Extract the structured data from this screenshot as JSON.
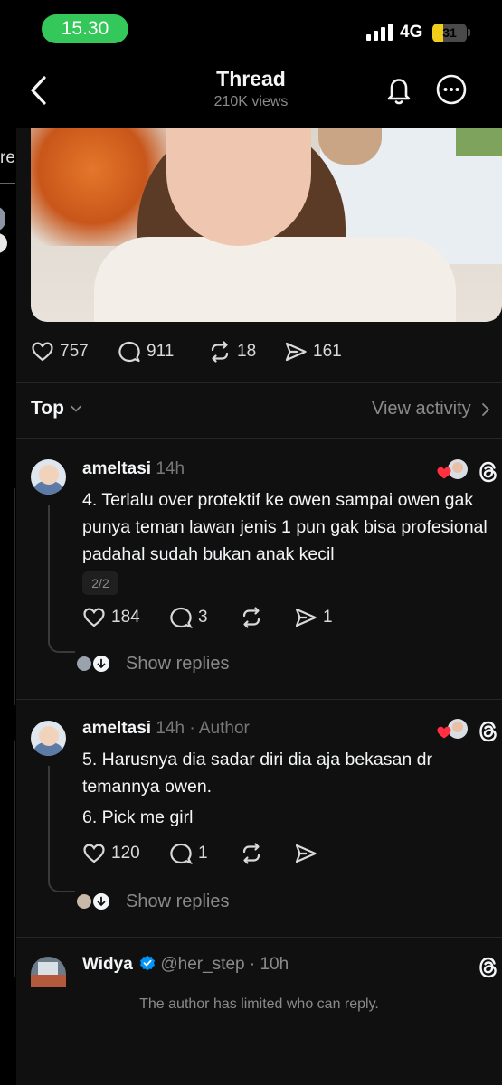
{
  "status_bar": {
    "time": "15.30",
    "network": "4G",
    "battery": "31",
    "battery_level": 0.31
  },
  "header": {
    "title": "Thread",
    "subtitle": "210K views",
    "icons": [
      "back-chevron-icon",
      "bell-icon",
      "more-icon"
    ]
  },
  "background_page": {
    "partial_label": "re"
  },
  "post": {
    "likes": "757",
    "replies": "911",
    "reposts": "18",
    "shares": "161"
  },
  "filter": {
    "sort_label": "Top",
    "view_activity": "View activity"
  },
  "replies": [
    {
      "username": "ameltasi",
      "time": "14h",
      "author_tag": "",
      "lines": [
        "4. Terlalu over protektif ke owen sampai owen gak punya teman lawan jenis 1 pun gak bisa profesional padahal sudah bukan anak kecil"
      ],
      "badge": "2/2",
      "likes": "184",
      "replies": "3",
      "reposts": "",
      "shares": "1",
      "show_replies": "Show replies"
    },
    {
      "username": "ameltasi",
      "time": "14h",
      "author_tag": "· Author",
      "lines": [
        "5. Harusnya dia sadar diri dia aja bekasan dr temannya owen.",
        "6. Pick me girl"
      ],
      "likes": "120",
      "replies": "1",
      "reposts": "",
      "shares": "",
      "show_replies": "Show replies"
    }
  ],
  "third_reply": {
    "username": "Widya",
    "handle": "@her_step",
    "time": "· 10h",
    "limited_notice": "The author has limited who can reply."
  },
  "colors": {
    "background": "#000000",
    "sheet": "#101010",
    "status_pill": "#34c759",
    "battery": "#f2cc1b",
    "verified": "#0095f6",
    "heart": "#ff3040"
  }
}
